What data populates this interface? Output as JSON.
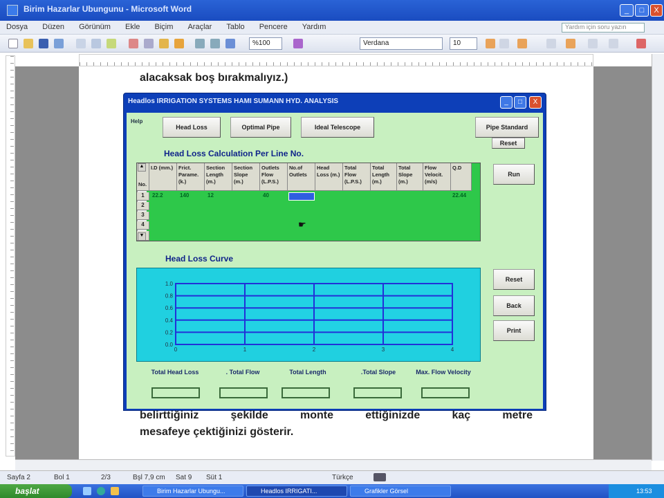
{
  "window": {
    "title": "Birim Hazarlar Ubungunu - Microsoft Word",
    "min": "_",
    "max": "□",
    "close": "X"
  },
  "menu": [
    "Dosya",
    "Düzen",
    "Görünüm",
    "Ekle",
    "Biçim",
    "Araçlar",
    "Tablo",
    "Pencere",
    "Yardım"
  ],
  "help_placeholder": "Yardım için soru yazın",
  "toolbar": {
    "zoom": "%100",
    "font": "Verdana",
    "size": "10"
  },
  "document": {
    "line1": "alacaksak boş bırakmalıyız.)",
    "line2": "belirttiğiniz şekilde monte ettiğinizde kaç metre",
    "line3": "mesafeye çektiğinizi gösterir."
  },
  "dialog": {
    "title": "Headlos IRRIGATION SYSTEMS HAMI SUMANN HYD. ANALYSIS",
    "help": "Help",
    "buttons": {
      "head_loss": "Head Loss",
      "optimal_pipe": "Optimal Pipe",
      "ideal_telescope": "Ideal Telescope",
      "pipe_standard": "Pipe Standard",
      "reset_top": "Reset",
      "run": "Run",
      "reset": "Reset",
      "back": "Back",
      "print": "Print"
    },
    "grid_heading": "Head Loss Calculation Per Line No.",
    "grid": {
      "row_header": "No.",
      "columns": [
        "I.D (mm.)",
        "Frict. Parame. (k.)",
        "Section Length (m.)",
        "Section Slope (m.)",
        "Outlets Flow (L.P.S.)",
        "No.of Outlets",
        "Head Loss (m.)",
        "Total Flow (L.P.S.)",
        "Total Length (m.)",
        "Total Slope (m.)",
        "Flow Velocit. (m/s)",
        "Q.D"
      ],
      "rows": [
        "1",
        "2",
        "3",
        "4"
      ],
      "row1": [
        "22.2",
        "140",
        "12",
        "",
        "40",
        "",
        "",
        "",
        "",
        "",
        "",
        "22.44"
      ]
    },
    "chart_heading": "Head Loss Curve",
    "chart_data": {
      "type": "line",
      "series": [],
      "x_ticks": [
        "0",
        "1",
        "2",
        "3",
        "4"
      ],
      "y_ticks": [
        "0.0",
        "0.2",
        "0.4",
        "0.6",
        "0.8",
        "1.0"
      ],
      "xlim": [
        0,
        4
      ],
      "ylim": [
        0,
        1
      ],
      "grid": true
    },
    "outputs": [
      "Total Head Loss",
      ". Total Flow",
      "Total Length",
      ".Total Slope",
      "Max. Flow Velocity"
    ]
  },
  "status": {
    "page": "Sayfa 2",
    "section": "Bol 1",
    "pages": "2/3",
    "at": "Bşl 7,9 cm",
    "line": "Sat 9",
    "col": "Süt 1",
    "lang": "Türkçe"
  },
  "taskbar": {
    "start": "başlat",
    "tasks": [
      "Birim Hazarlar Ubungu...",
      "Headlos IRRIGATI...",
      "Grafikler Görsel"
    ],
    "clock": "13:53"
  }
}
